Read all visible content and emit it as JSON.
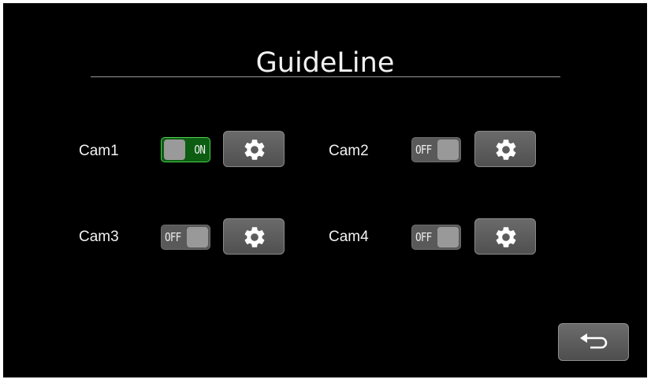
{
  "title": "GuideLine",
  "cameras": [
    {
      "label": "Cam1",
      "state": "ON",
      "enabled": true
    },
    {
      "label": "Cam2",
      "state": "OFF",
      "enabled": false
    },
    {
      "label": "Cam3",
      "state": "OFF",
      "enabled": false
    },
    {
      "label": "Cam4",
      "state": "OFF",
      "enabled": false
    }
  ],
  "icons": {
    "settings": "gear-icon",
    "back": "return-arrow-icon"
  },
  "colors": {
    "background": "#000000",
    "toggle_on": "#0c5d12",
    "toggle_on_border": "#4fd14f",
    "toggle_off": "#595959"
  }
}
